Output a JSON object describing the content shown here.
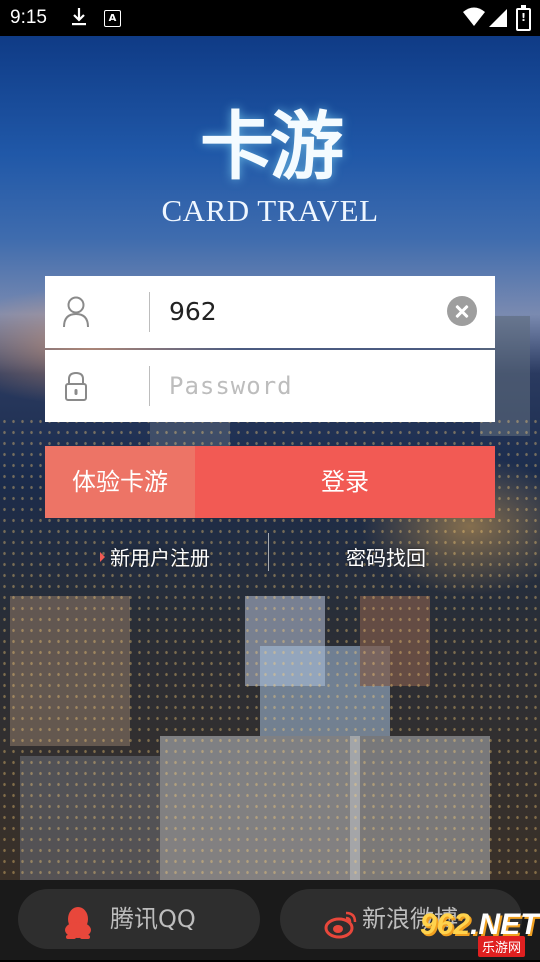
{
  "status_bar": {
    "time": "9:15",
    "download_icon": "download-icon",
    "notification_badge": "A",
    "battery_label": "!"
  },
  "logo": {
    "title_zh": "卡游",
    "title_en": "CARD TRAVEL"
  },
  "login_form": {
    "username_value": "962",
    "password_placeholder": "Password",
    "username_icon": "person-icon",
    "password_icon": "lock-icon",
    "clear_icon": "clear-icon"
  },
  "buttons": {
    "try_label": "体验卡游",
    "login_label": "登录"
  },
  "links": {
    "register_label": "新用户注册",
    "forgot_label": "密码找回"
  },
  "social": {
    "qq_label": "腾讯QQ",
    "weibo_label": "新浪微博"
  },
  "watermark": {
    "number": "962",
    "suffix": ".NET",
    "site": "乐游网"
  },
  "colors": {
    "login_button": "#f25a54",
    "try_button": "#ed7466",
    "qq_icon": "#e8473b",
    "weibo_icon": "#e8473b"
  }
}
